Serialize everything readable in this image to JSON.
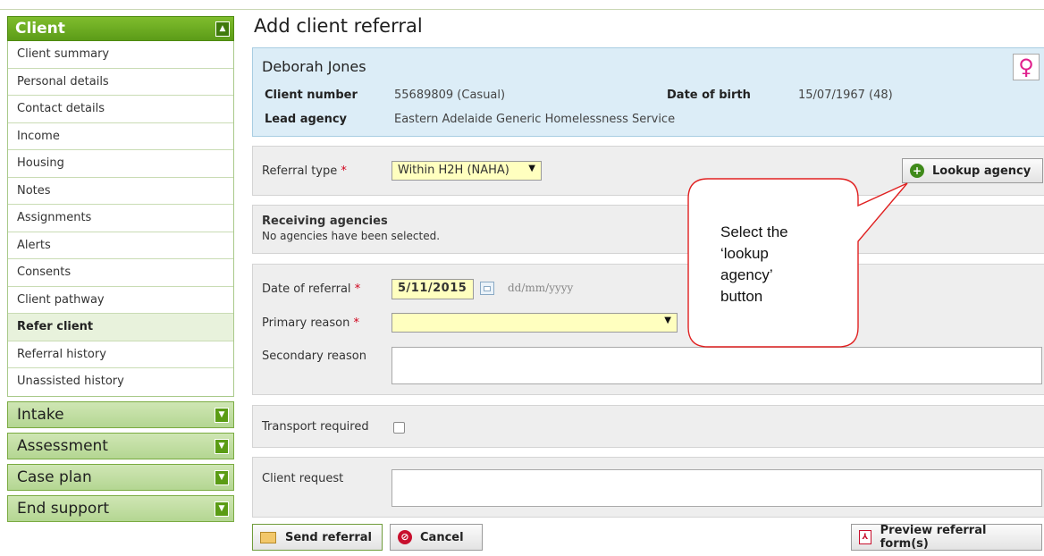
{
  "sidebar": {
    "client": {
      "title": "Client",
      "items": [
        {
          "label": "Client summary"
        },
        {
          "label": "Personal details"
        },
        {
          "label": "Contact details"
        },
        {
          "label": "Income"
        },
        {
          "label": "Housing"
        },
        {
          "label": "Notes"
        },
        {
          "label": "Assignments"
        },
        {
          "label": "Alerts"
        },
        {
          "label": "Consents"
        },
        {
          "label": "Client pathway"
        },
        {
          "label": "Refer client"
        },
        {
          "label": "Referral history"
        },
        {
          "label": "Unassisted history"
        }
      ],
      "active_item": "Refer client"
    },
    "sections": [
      {
        "title": "Intake"
      },
      {
        "title": "Assessment"
      },
      {
        "title": "Case plan"
      },
      {
        "title": "End support"
      }
    ]
  },
  "page": {
    "title": "Add client referral"
  },
  "client": {
    "name": "Deborah Jones",
    "gender_symbol": "♀",
    "client_number_label": "Client number",
    "client_number": "55689809 (Casual)",
    "dob_label": "Date of birth",
    "dob": "15/07/1967 (48)",
    "lead_agency_label": "Lead agency",
    "lead_agency": "Eastern Adelaide Generic Homelessness Service"
  },
  "referral": {
    "type_label": "Referral type",
    "type_value": "Within H2H (NAHA)",
    "lookup_button": "Lookup agency"
  },
  "receiving": {
    "heading": "Receiving agencies",
    "empty_text": "No agencies have been selected."
  },
  "details": {
    "date_label": "Date of referral",
    "date_value": "5/11/2015",
    "date_placeholder": "dd/mm/yyyy",
    "primary_label": "Primary reason",
    "primary_value": "",
    "secondary_label": "Secondary reason"
  },
  "transport": {
    "label": "Transport required",
    "checked": false
  },
  "request": {
    "label": "Client request"
  },
  "actions": {
    "send": "Send referral",
    "cancel": "Cancel",
    "preview": "Preview referral form(s)"
  },
  "callout": {
    "lines": [
      "Select the",
      "‘lookup",
      "agency’",
      "button"
    ]
  },
  "colors": {
    "accent_green": "#5c9c18",
    "client_panel_blue": "#dcedf7",
    "required_red": "#d0021b",
    "callout_red": "#e02020",
    "field_yellow": "#ffffbf"
  }
}
